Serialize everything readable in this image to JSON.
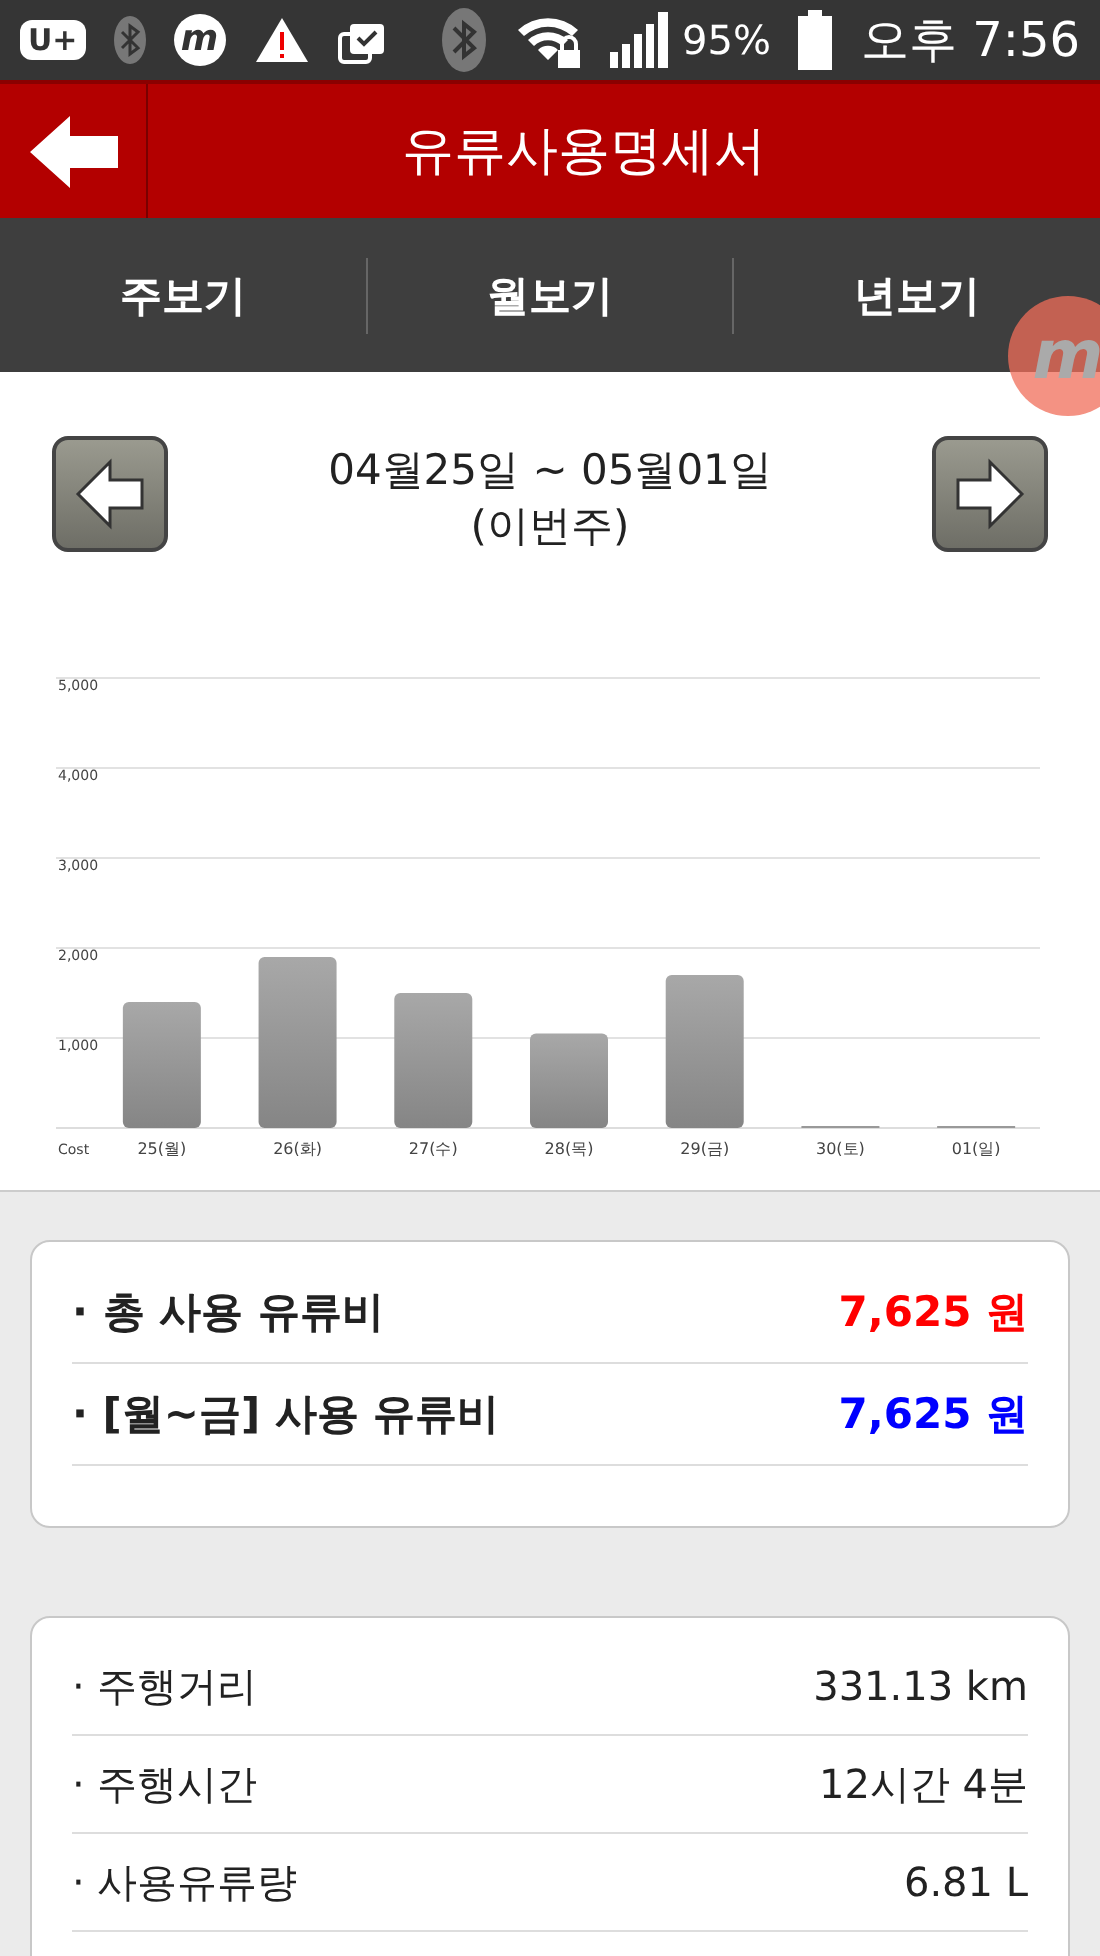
{
  "status_bar": {
    "left_icons": [
      "U+",
      "m"
    ],
    "battery": "95%",
    "time": "오후 7:56"
  },
  "header": {
    "title": "유류사용명세서"
  },
  "tabs": [
    {
      "label": "주보기"
    },
    {
      "label": "월보기"
    },
    {
      "label": "년보기"
    }
  ],
  "floating_badge": {
    "label": "m"
  },
  "date_nav": {
    "range": "04월25일 ~ 05월01일",
    "note": "(이번주)"
  },
  "chart": {
    "chart_data": {
      "type": "bar",
      "xlabel": "Cost",
      "grid": true,
      "categories": [
        "25(월)",
        "26(화)",
        "27(수)",
        "28(목)",
        "29(금)",
        "30(토)",
        "01(일)"
      ],
      "values": [
        1400,
        1900,
        1500,
        1050,
        1700,
        0,
        0
      ],
      "ylim": [
        0,
        5000
      ],
      "yticks": [
        {
          "value": 1000,
          "label": "1,000"
        },
        {
          "value": 2000,
          "label": "2,000"
        },
        {
          "value": 3000,
          "label": "3,000"
        },
        {
          "value": 4000,
          "label": "4,000"
        },
        {
          "value": 5000,
          "label": "5,000"
        }
      ]
    }
  },
  "cost_summary": [
    {
      "label": "· 총 사용 유류비",
      "value": "7,625 원",
      "color": "#ff0000"
    },
    {
      "label": "· [월~금] 사용 유류비",
      "value": "7,625 원",
      "color": "#0000ff"
    }
  ],
  "driving_stats": [
    {
      "label": "· 주행거리",
      "value": "331.13 km"
    },
    {
      "label": "· 주행시간",
      "value": "12시간 4분"
    },
    {
      "label": "· 사용유류량",
      "value": "6.81 L"
    }
  ]
}
